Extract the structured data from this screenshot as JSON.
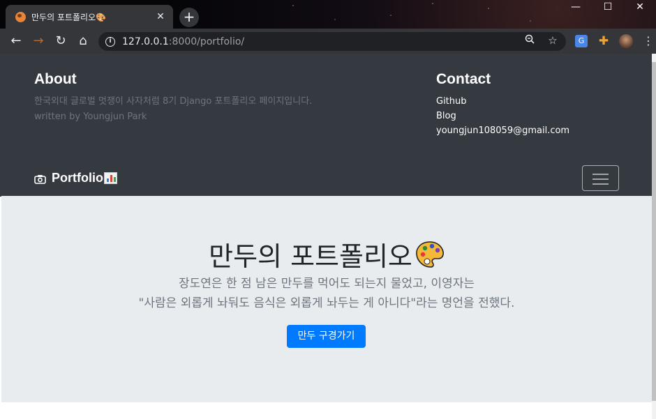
{
  "browser": {
    "tab_title": "만두의 포트폴리오🎨",
    "close_label": "✕",
    "newtab_label": "+",
    "url_host": "127.0.0.1",
    "url_path": ":8000/portfolio/",
    "window_controls": [
      "—",
      "☐",
      "✕"
    ],
    "colors": {
      "chrome_bg": "#35363a",
      "omnibox_bg": "#202124"
    }
  },
  "header": {
    "about_title": "About",
    "about_text_line1": "한국외대 글로벌 멋쟁이 사자처럼 8기 Django 포트폴리오 페이지입니다.",
    "about_text_line2": "written by Youngjun Park",
    "contact_title": "Contact",
    "contact_items": [
      "Github",
      "Blog",
      "youngjun108059@gmail.com"
    ],
    "colors": {
      "bg": "#343a40",
      "muted": "#6c757d"
    }
  },
  "navbar": {
    "brand_label": "Portfolio",
    "brand_icon": "camera-icon",
    "brand_emoji": "chart-emoji"
  },
  "jumbotron": {
    "title": "만두의 포트폴리오",
    "title_emoji": "palette-icon",
    "lead_line1": "장도연은 한 점 남은 만두를 먹어도 되는지 물었고, 이영자는",
    "lead_line2": "\"사람은 외롭게 놔둬도 음식은 외롭게 놔두는 게 아니다\"라는 명언을 전했다.",
    "button_label": "만두 구경가기",
    "colors": {
      "bg": "#e9ecef",
      "button": "#007bff"
    }
  }
}
